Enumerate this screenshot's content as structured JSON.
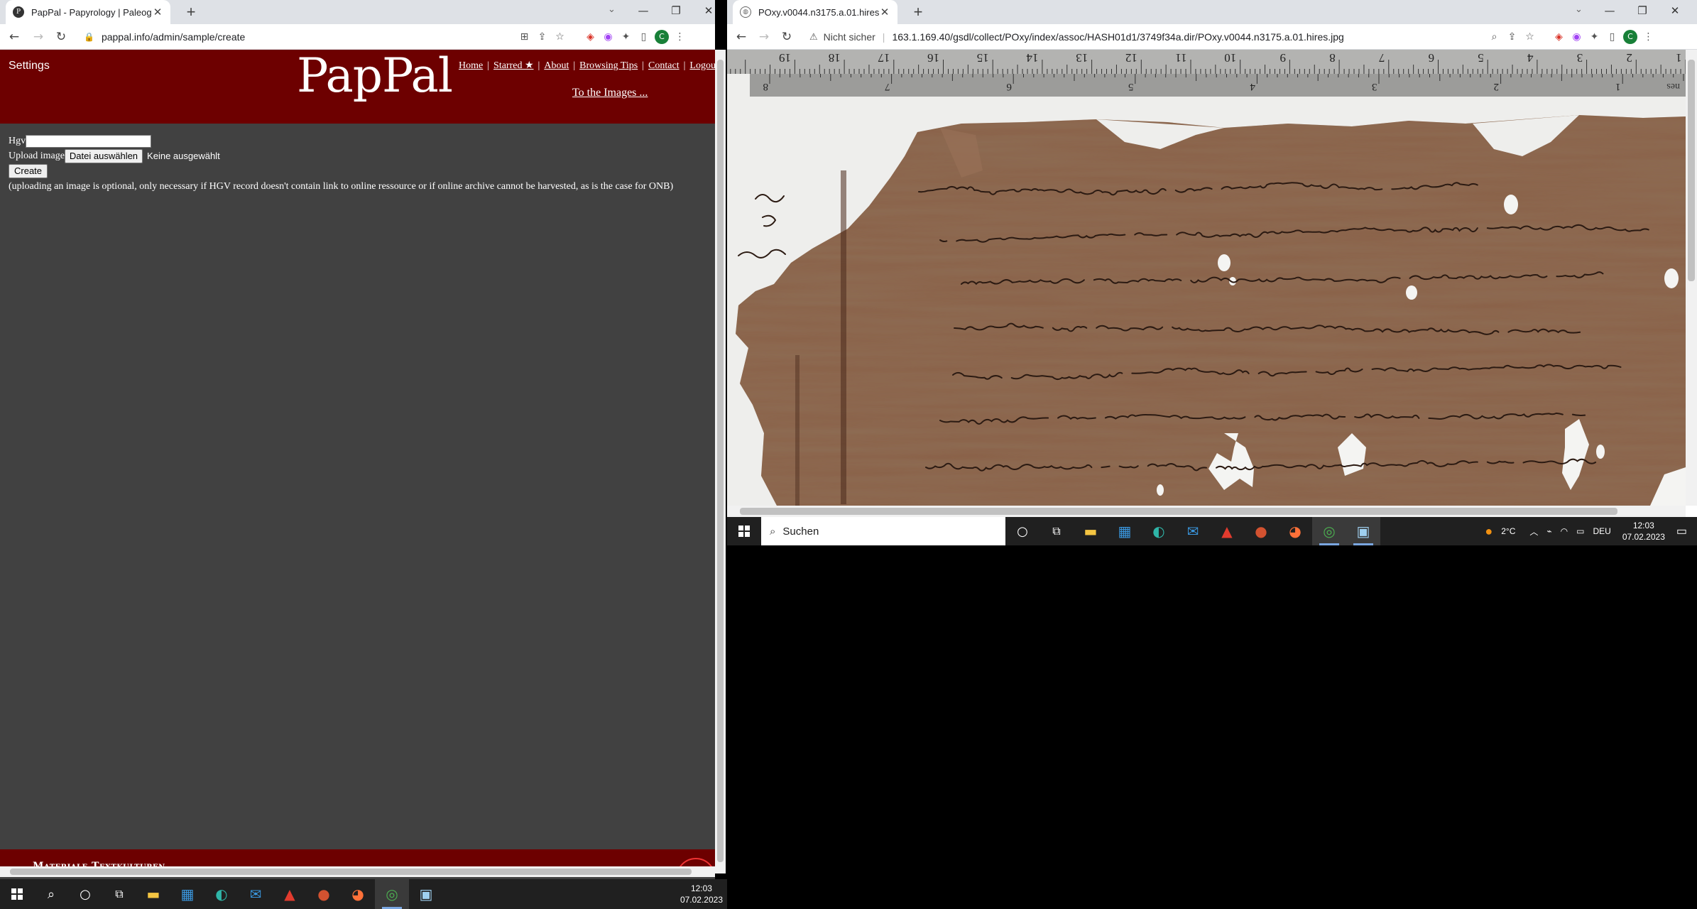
{
  "left_browser": {
    "tab_title": "PapPal - Papyrology | Paleograph",
    "favicon_glyph": "P",
    "url": "pappal.info/admin/sample/create",
    "window_controls": [
      "⌄",
      "—",
      "❐",
      "✕"
    ]
  },
  "pappal": {
    "settings_label": "Settings",
    "logo": "PapPal",
    "nav": [
      "Home",
      "Starred ★",
      "About",
      "Browsing Tips",
      "Contact",
      "Logout"
    ],
    "images_link": "To the Images ...",
    "form": {
      "hgv_label": "Hgv",
      "hgv_value": "",
      "upload_label": "Upload image",
      "file_button": "Datei auswählen",
      "file_status": "Keine ausgewählt",
      "create_button": "Create",
      "note": "(uploading an image is optional, only necessary if HGV record doesn't contain link to online ressource or if online archive cannot be harvested, as is the case for ONB)"
    },
    "footer_text": "Materiale Textkulturen",
    "colors": {
      "header_bg": "#6d0000",
      "page_bg": "#414141"
    }
  },
  "right_browser": {
    "tab_title": "POxy.v0044.n3175.a.01.hires.jpg",
    "security_label": "Nicht sicher",
    "url": "163.1.169.40/gsdl/collect/POxy/index/assoc/HASH01d1/3749f34a.dir/POxy.v0044.n3175.a.01.hires.jpg"
  },
  "ruler": {
    "cm_labels": [
      "19",
      "18",
      "17",
      "16",
      "15",
      "14",
      "13",
      "12",
      "11",
      "10",
      "9",
      "8",
      "7",
      "6",
      "5",
      "4",
      "3",
      "2",
      "1"
    ],
    "inch_labels": [
      "8",
      "7",
      "6",
      "5",
      "4",
      "3",
      "2",
      "1"
    ],
    "inch_unit": "nes"
  },
  "taskbar_left": {
    "clock_time": "12:03",
    "clock_date": "07.02.2023"
  },
  "taskbar_right": {
    "search_placeholder": "Suchen",
    "weather": "2°C",
    "language": "DEU",
    "clock_time": "12:03",
    "clock_date": "07.02.2023"
  }
}
